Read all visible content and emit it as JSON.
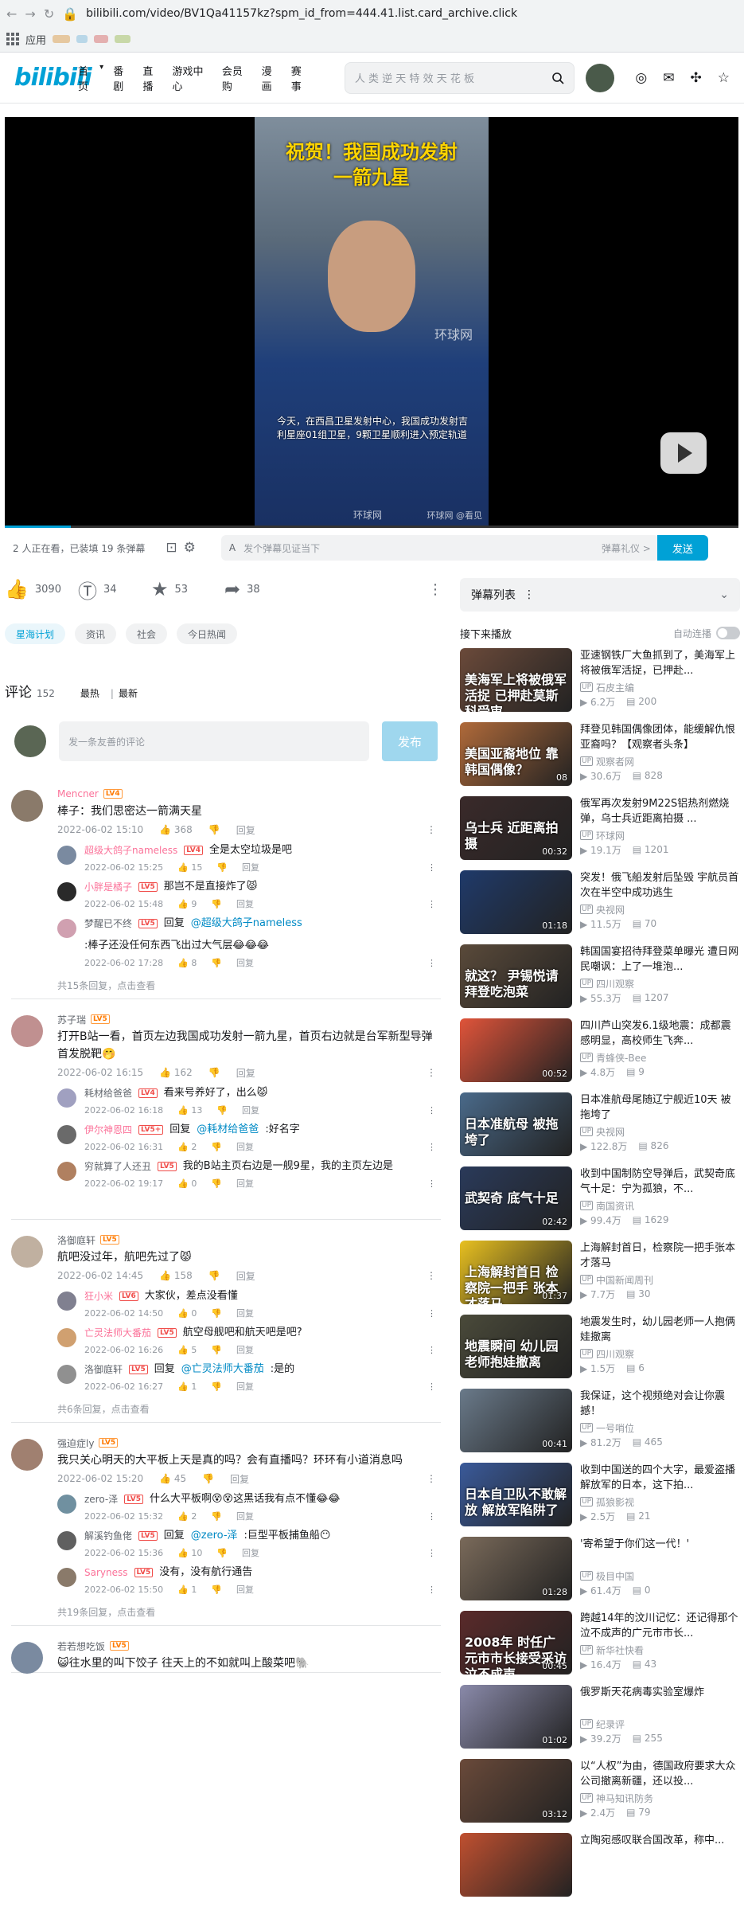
{
  "browser": {
    "url": "bilibili.com/video/BV1Qa41157kz?spm_id_from=444.41.list.card_archive.click",
    "apps_label": "应用"
  },
  "header": {
    "logo": "bilibili",
    "nav": [
      "首页",
      "番剧",
      "直播",
      "游戏中心",
      "会员购",
      "漫画",
      "赛事"
    ],
    "search_placeholder": "人 类 逆 天 特 效 天 花 板"
  },
  "video": {
    "overlay_title_1": "祝贺！我国成功发射",
    "overlay_title_2": "一箭九星",
    "subtitle": "今天，在西昌卫星发射中心，我国成功发射吉利星座01组卫星，9颗卫星顺利进入预定轨道",
    "watermark": "环球网",
    "watermark2": "环球网",
    "watermark3": "环球网 @看见"
  },
  "danmaku": {
    "status": "2 人正在看，已装填 19 条弹幕",
    "placeholder": "发个弹幕见证当下",
    "etiquette": "弹幕礼仪 >",
    "send": "发送"
  },
  "toolbar": {
    "like": "3090",
    "coin": "34",
    "fav": "53",
    "share": "38"
  },
  "tags": [
    "星海计划",
    "资讯",
    "社会",
    "今日热闻"
  ],
  "comments_head": {
    "title": "评论",
    "count": "152",
    "sort_hot": "最热",
    "sort_new": "最新",
    "input_placeholder": "发一条友善的评论",
    "post_button": "发布"
  },
  "comments": [
    {
      "user": "Mencner",
      "level": "LV4",
      "pink": true,
      "text": "棒子：我们思密达一箭满天星",
      "time": "2022-06-02 15:10",
      "likes": "368",
      "reply_label": "回复",
      "replies": [
        {
          "user": "超级大鸽子nameless",
          "level": "LV4",
          "text": "全是太空垃圾是吧",
          "time": "2022-06-02 15:25",
          "likes": "15",
          "pink": true
        },
        {
          "user": "小胖是橘子",
          "level": "LV5",
          "text": "那岂不是直接炸了😾",
          "time": "2022-06-02 15:48",
          "likes": "9",
          "pink": true
        },
        {
          "user": "梦醒已不终",
          "level": "LV5",
          "prefix": "回复",
          "at": "@超级大鸽子nameless",
          "text": ":棒子还没任何东西飞出过大气层😂😂😂",
          "time": "2022-06-02 17:28",
          "likes": "8",
          "pink": false
        }
      ],
      "more": "共15条回复，点击查看"
    },
    {
      "user": "苏子瑞",
      "level": "LV5",
      "pink": false,
      "text": "打开B站一看，首页左边我国成功发射一箭九星，首页右边就是台军新型导弹首发脱靶🤭",
      "time": "2022-06-02 16:15",
      "likes": "162",
      "reply_label": "回复",
      "replies": [
        {
          "user": "耗材给爸爸",
          "level": "LV4",
          "text": "看来号养好了，出么😾",
          "time": "2022-06-02 16:18",
          "likes": "13",
          "pink": false
        },
        {
          "user": "伊尔神恩四",
          "level": "LV5+",
          "prefix": "回复",
          "at": "@耗材给爸爸",
          "text": ":好名字",
          "time": "2022-06-02 16:31",
          "likes": "2",
          "pink": true
        },
        {
          "user": "穷就算了人还丑",
          "level": "LV5",
          "text": "我的B站主页右边是一舰9星，我的主页左边是",
          "time": "2022-06-02 19:17",
          "likes": "0",
          "pink": false
        }
      ],
      "more": ""
    },
    {
      "user": "洛御庭轩",
      "level": "LV5",
      "pink": false,
      "text": "航吧没过年，航吧先过了😾",
      "time": "2022-06-02 14:45",
      "likes": "158",
      "reply_label": "回复",
      "replies": [
        {
          "user": "狂小米",
          "level": "LV6",
          "text": "大家伙，差点没看懂",
          "time": "2022-06-02 14:50",
          "likes": "0",
          "pink": true
        },
        {
          "user": "亡灵法师大番茄",
          "level": "LV5",
          "text": "航空母舰吧和航天吧是吧?",
          "time": "2022-06-02 16:26",
          "likes": "5",
          "pink": true
        },
        {
          "user": "洛御庭轩",
          "level": "LV5",
          "prefix": "回复",
          "at": "@亡灵法师大番茄",
          "text": ":是的",
          "time": "2022-06-02 16:27",
          "likes": "1",
          "pink": false
        }
      ],
      "more": "共6条回复，点击查看"
    },
    {
      "user": "强迫症ly",
      "level": "LV5",
      "pink": false,
      "text": "我只关心明天的大平板上天是真的吗？会有直播吗？环环有小道消息吗",
      "time": "2022-06-02 15:20",
      "likes": "45",
      "reply_label": "回复",
      "replies": [
        {
          "user": "zero-泽",
          "level": "LV5",
          "text": "什么大平板啊😵😵这黑话我有点不懂😂😂",
          "time": "2022-06-02 15:32",
          "likes": "2",
          "pink": false
        },
        {
          "user": "解溪钓鱼佬",
          "level": "LV5",
          "prefix": "回复",
          "at": "@zero-泽",
          "text": ":巨型平板捕鱼船😶",
          "time": "2022-06-02 15:36",
          "likes": "10",
          "pink": false
        },
        {
          "user": "Saryness",
          "level": "LV5",
          "text": "没有，没有航行通告",
          "time": "2022-06-02 15:50",
          "likes": "1",
          "pink": true
        }
      ],
      "more": "共19条回复，点击查看"
    },
    {
      "user": "若若想吃饭",
      "level": "LV5",
      "pink": false,
      "text": "😺往水里的叫下饺子 往天上的不如就叫上酸菜吧🐘",
      "time": "",
      "likes": "",
      "reply_label": "",
      "replies": [],
      "more": ""
    }
  ],
  "right": {
    "danmaku_list": "弹幕列表",
    "next_up": "接下来播放",
    "autoplay": "自动连播",
    "recs": [
      {
        "title": "亚速钢铁厂大鱼抓到了，美海军上将被俄军活捉，已押赴...",
        "up": "石皮主编",
        "views": "6.2万",
        "dm": "200",
        "thumb_text": "美海军上将被俄军活捉 已押赴莫斯科受审",
        "dur": "",
        "color": "#6b4a3a"
      },
      {
        "title": "拜登见韩国偶像团体，能缓解仇恨亚裔吗？【观察者头条】",
        "up": "观察者网",
        "views": "30.6万",
        "dm": "828",
        "thumb_text": "美国亚裔地位 靠韩国偶像？",
        "dur": "08",
        "color": "#b06a3a"
      },
      {
        "title": "俄军再次发射9M22S铝热剂燃烧弹，乌士兵近距离拍摄 ...",
        "up": "环球网",
        "views": "19.1万",
        "dm": "1201",
        "thumb_text": "乌士兵 近距离拍摄",
        "dur": "00:32",
        "color": "#3a2a2a"
      },
      {
        "title": "突发！俄飞船发射后坠毁 宇航员首次在半空中成功逃生",
        "up": "央视网",
        "views": "11.5万",
        "dm": "70",
        "thumb_text": "",
        "dur": "01:18",
        "color": "#1f3a6a"
      },
      {
        "title": "韩国国宴招待拜登菜单曝光 遭日网民嘲讽：上了一堆泡...",
        "up": "四川观察",
        "views": "55.3万",
        "dm": "1207",
        "thumb_text": "就这？ 尹锡悦请拜登吃泡菜",
        "dur": "",
        "color": "#5a4a3a"
      },
      {
        "title": "四川芦山突发6.1级地震：成都震感明显，高校师生飞奔...",
        "up": "青蜂侠-Bee",
        "views": "4.8万",
        "dm": "9",
        "thumb_text": "",
        "dur": "00:52",
        "color": "#e0543a"
      },
      {
        "title": "日本准航母尾随辽宁舰近10天 被拖垮了",
        "up": "央视网",
        "views": "122.8万",
        "dm": "826",
        "thumb_text": "日本准航母 被拖垮了",
        "dur": "",
        "color": "#4a6a8a"
      },
      {
        "title": "收到中国制防空导弹后，武契奇底气十足：宁为孤狼，不...",
        "up": "南国资讯",
        "views": "99.4万",
        "dm": "1629",
        "thumb_text": "武契奇 底气十足",
        "dur": "02:42",
        "color": "#2a3a5a"
      },
      {
        "title": "上海解封首日，检察院一把手张本才落马",
        "up": "中国新闻周刊",
        "views": "7.7万",
        "dm": "30",
        "thumb_text": "上海解封首日 检察院一把手 张本才落马",
        "dur": "01:37",
        "color": "#e8c020"
      },
      {
        "title": "地震发生时，幼儿园老师一人抱俩娃撤离",
        "up": "四川观察",
        "views": "1.5万",
        "dm": "6",
        "thumb_text": "地震瞬间 幼儿园老师抱娃撤离",
        "dur": "",
        "color": "#4a4a3a"
      },
      {
        "title": "我保证，这个视频绝对会让你震撼！",
        "up": "一号哨位",
        "views": "81.2万",
        "dm": "465",
        "thumb_text": "",
        "dur": "00:41",
        "color": "#6a7a8a"
      },
      {
        "title": "收到中国送的四个大字，最爱盗播解放军的日本，这下拍...",
        "up": "孤狼影视",
        "views": "2.5万",
        "dm": "21",
        "thumb_text": "日本自卫队不敢解放 解放军陷阱了",
        "dur": "",
        "color": "#3a5a9a"
      },
      {
        "title": "'寄希望于你们这一代！'",
        "up": "极目中国",
        "views": "61.4万",
        "dm": "0",
        "thumb_text": "",
        "dur": "01:28",
        "color": "#7a6a5a"
      },
      {
        "title": "跨越14年的汶川记忆：还记得那个泣不成声的广元市市长...",
        "up": "新华社快看",
        "views": "16.4万",
        "dm": "43",
        "thumb_text": "2008年 时任广元市市长接受采访 泣不成声",
        "dur": "00:45",
        "color": "#5a2a2a"
      },
      {
        "title": "俄罗斯天花病毒实验室爆炸",
        "up": "纪录评",
        "views": "39.2万",
        "dm": "255",
        "thumb_text": "",
        "dur": "01:02",
        "color": "#8a8aaa"
      },
      {
        "title": "以“人权”为由，德国政府要求大众公司撤离新疆，还以投...",
        "up": "神马知讯防务",
        "views": "2.4万",
        "dm": "79",
        "thumb_text": "",
        "dur": "03:12",
        "color": "#6a4a3a"
      },
      {
        "title": "立陶宛感叹联合国改革，称中...",
        "up": "",
        "views": "",
        "dm": "",
        "thumb_text": "",
        "dur": "",
        "color": "#c05030"
      }
    ]
  }
}
